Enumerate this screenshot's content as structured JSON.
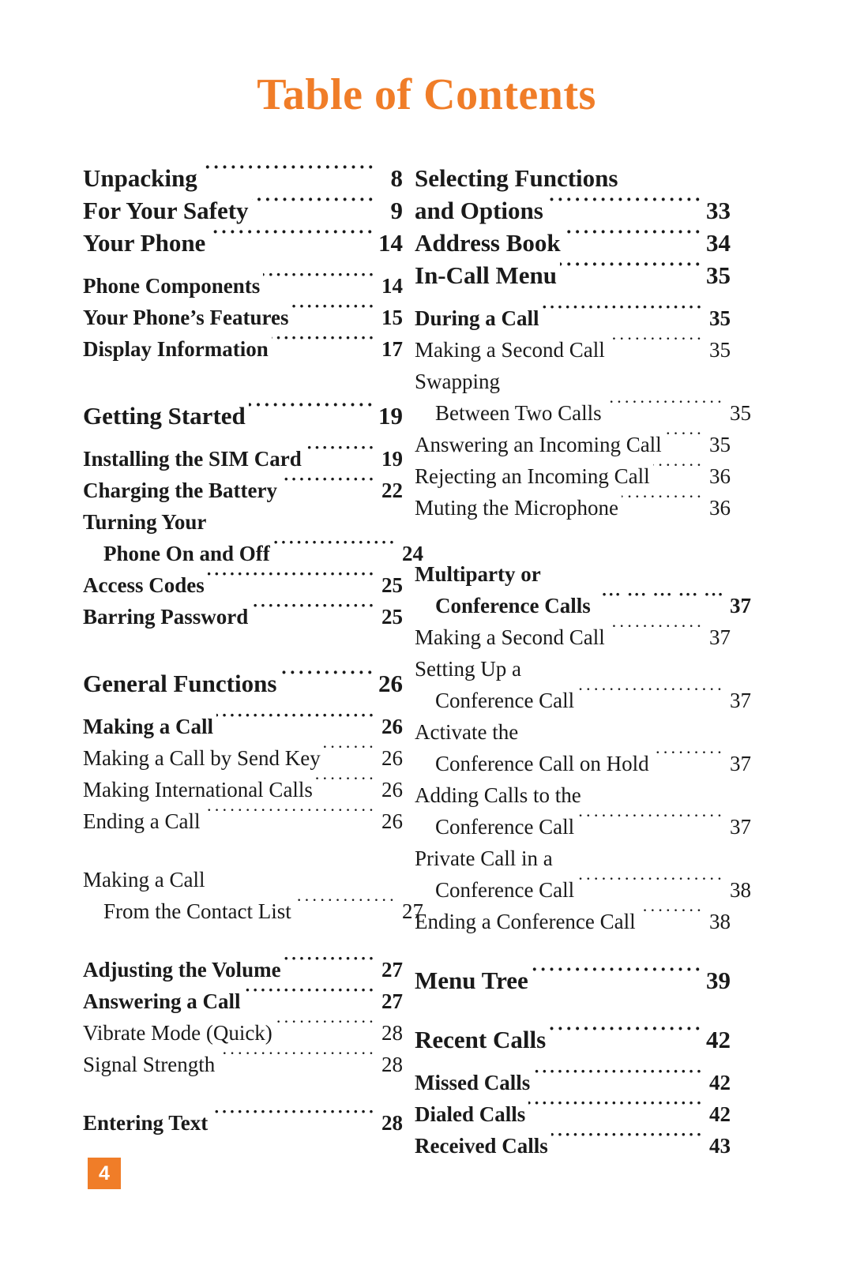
{
  "document": {
    "title": "Table of Contents",
    "page_number": "4",
    "accent_color": "#F07D28",
    "text_color": "#1a1a1a"
  },
  "columns": {
    "left": [
      {
        "type": "entry",
        "level": 1,
        "title": "Unpacking",
        "page": "8"
      },
      {
        "type": "entry",
        "level": 1,
        "title": "For Your Safety",
        "page": "9"
      },
      {
        "type": "entry",
        "level": 1,
        "title": "Your Phone",
        "page": "14"
      },
      {
        "type": "gap",
        "size": "sm"
      },
      {
        "type": "entry",
        "level": 2,
        "title": "Phone Components",
        "page": "14"
      },
      {
        "type": "entry",
        "level": 2,
        "title": "Your Phone’s Features",
        "page": "15"
      },
      {
        "type": "entry",
        "level": 2,
        "title": "Display Information",
        "page": "17"
      },
      {
        "type": "gap",
        "size": "lg"
      },
      {
        "type": "entry",
        "level": 1,
        "title": "Getting Started",
        "page": "19"
      },
      {
        "type": "gap",
        "size": "sm"
      },
      {
        "type": "entry",
        "level": 2,
        "title": "Installing the SIM Card",
        "page": "19"
      },
      {
        "type": "entry",
        "level": 2,
        "title": "Charging the Battery",
        "page": "22"
      },
      {
        "type": "wrap",
        "level": 2,
        "title": "Turning Your"
      },
      {
        "type": "entry",
        "level": 2,
        "title": "Phone On and Off",
        "page": "24",
        "indent": true
      },
      {
        "type": "entry",
        "level": 2,
        "title": "Access Codes",
        "page": "25"
      },
      {
        "type": "entry",
        "level": 2,
        "title": "Barring Password",
        "page": "25"
      },
      {
        "type": "gap",
        "size": "lg"
      },
      {
        "type": "entry",
        "level": 1,
        "title": "General Functions",
        "page": "26"
      },
      {
        "type": "gap",
        "size": "sm"
      },
      {
        "type": "entry",
        "level": 2,
        "title": "Making a Call",
        "page": "26"
      },
      {
        "type": "entry",
        "level": 3,
        "title": "Making a Call by Send Key",
        "page": "26"
      },
      {
        "type": "entry",
        "level": 3,
        "title": "Making International Calls",
        "page": "26"
      },
      {
        "type": "entry",
        "level": 3,
        "title": "Ending a Call",
        "page": "26"
      },
      {
        "type": "gap",
        "size": "md"
      },
      {
        "type": "wrap",
        "level": 3,
        "title": "Making a Call"
      },
      {
        "type": "entry",
        "level": 3,
        "title": "From the Contact List",
        "page": "27",
        "indent": true
      },
      {
        "type": "gap",
        "size": "md"
      },
      {
        "type": "entry",
        "level": 2,
        "title": "Adjusting the Volume",
        "page": "27"
      },
      {
        "type": "entry",
        "level": 2,
        "title": "Answering a Call",
        "page": "27"
      },
      {
        "type": "entry",
        "level": 3,
        "title": "Vibrate Mode (Quick)",
        "page": "28"
      },
      {
        "type": "entry",
        "level": 3,
        "title": "Signal Strength",
        "page": "28"
      },
      {
        "type": "gap",
        "size": "md"
      },
      {
        "type": "entry",
        "level": 2,
        "title": "Entering Text",
        "page": "28"
      }
    ],
    "right": [
      {
        "type": "wrap",
        "level": 1,
        "title": "Selecting Functions"
      },
      {
        "type": "entry",
        "level": 1,
        "title": "and Options",
        "page": "33"
      },
      {
        "type": "entry",
        "level": 1,
        "title": "Address Book",
        "page": "34"
      },
      {
        "type": "entry",
        "level": 1,
        "title": "In-Call Menu",
        "page": "35"
      },
      {
        "type": "gap",
        "size": "sm"
      },
      {
        "type": "entry",
        "level": 2,
        "title": "During a Call",
        "page": "35"
      },
      {
        "type": "entry",
        "level": 3,
        "title": "Making a Second Call",
        "page": "35"
      },
      {
        "type": "wrap",
        "level": 3,
        "title": "Swapping"
      },
      {
        "type": "entry",
        "level": 3,
        "title": "Between Two Calls",
        "page": "35",
        "indent": true
      },
      {
        "type": "entry",
        "level": 3,
        "title": "Answering an Incoming Call",
        "page": "35"
      },
      {
        "type": "entry",
        "level": 3,
        "title": "Rejecting an Incoming Call",
        "page": "36"
      },
      {
        "type": "entry",
        "level": 3,
        "title": "Muting the Microphone",
        "page": "36"
      },
      {
        "type": "gap",
        "size": "lg"
      },
      {
        "type": "wrap",
        "level": 2,
        "title": "Multiparty or"
      },
      {
        "type": "entry",
        "level": 2,
        "title": "Conference Calls",
        "page": "37",
        "indent": true,
        "widedots": true
      },
      {
        "type": "entry",
        "level": 3,
        "title": "Making a Second Call",
        "page": "37"
      },
      {
        "type": "wrap",
        "level": 3,
        "title": "Setting Up a"
      },
      {
        "type": "entry",
        "level": 3,
        "title": "Conference Call",
        "page": "37",
        "indent": true
      },
      {
        "type": "wrap",
        "level": 3,
        "title": "Activate the"
      },
      {
        "type": "entry",
        "level": 3,
        "title": "Conference Call on Hold",
        "page": "37",
        "indent": true
      },
      {
        "type": "wrap",
        "level": 3,
        "title": "Adding Calls to the"
      },
      {
        "type": "entry",
        "level": 3,
        "title": "Conference Call",
        "page": "37",
        "indent": true
      },
      {
        "type": "wrap",
        "level": 3,
        "title": "Private Call in a"
      },
      {
        "type": "entry",
        "level": 3,
        "title": "Conference Call",
        "page": "38",
        "indent": true
      },
      {
        "type": "entry",
        "level": 3,
        "title": "Ending a Conference Call",
        "page": "38"
      },
      {
        "type": "gap",
        "size": "md"
      },
      {
        "type": "entry",
        "level": 1,
        "title": "Menu Tree",
        "page": "39"
      },
      {
        "type": "gap",
        "size": "md"
      },
      {
        "type": "entry",
        "level": 1,
        "title": "Recent Calls",
        "page": "42"
      },
      {
        "type": "gap",
        "size": "sm"
      },
      {
        "type": "entry",
        "level": 2,
        "title": "Missed Calls",
        "page": "42"
      },
      {
        "type": "entry",
        "level": 2,
        "title": "Dialed Calls",
        "page": "42"
      },
      {
        "type": "entry",
        "level": 2,
        "title": "Received Calls",
        "page": "43"
      }
    ]
  }
}
